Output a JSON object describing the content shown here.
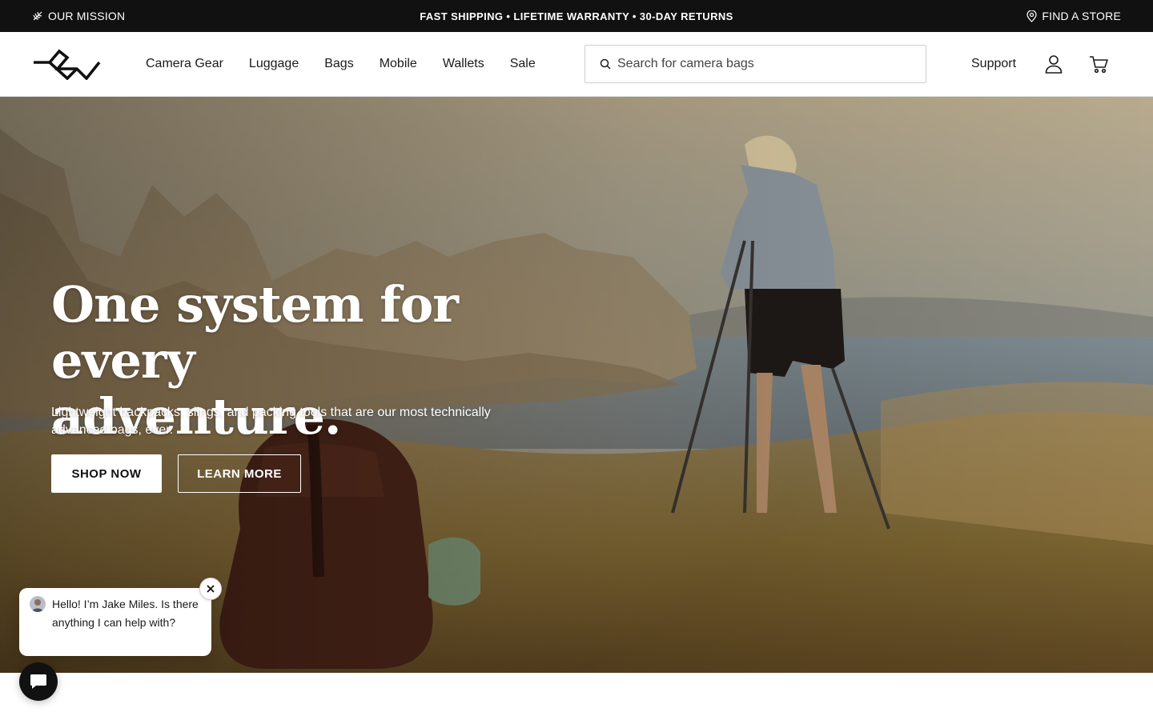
{
  "topbar": {
    "mission_label": "OUR MISSION",
    "promo_text": "FAST SHIPPING • LIFETIME WARRANTY • 30-DAY RETURNS",
    "store_label": "FIND A STORE"
  },
  "header": {
    "nav": [
      "Camera Gear",
      "Luggage",
      "Bags",
      "Mobile",
      "Wallets",
      "Sale"
    ],
    "search_placeholder": "Search for camera bags",
    "support_label": "Support"
  },
  "hero": {
    "title_line1": "One system for every",
    "title_line2": "adventure.",
    "subtitle": "Lightweight backpacks, slings, and packing tools that are our most technically advanced bags, ever.",
    "shop_button": "SHOP NOW",
    "learn_button": "LEARN MORE"
  },
  "chat": {
    "message": "Hello! I’m Jake Miles. Is there anything I can help with?"
  },
  "colors": {
    "topbar_bg": "#111111",
    "text": "#1a1a1a",
    "hero_text": "#ffffff"
  },
  "icons": {
    "mission": "mission-leaf-icon",
    "store": "location-pin-icon",
    "search": "search-icon",
    "account": "account-icon",
    "cart": "cart-icon",
    "close": "close-icon",
    "chat": "chat-icon"
  }
}
